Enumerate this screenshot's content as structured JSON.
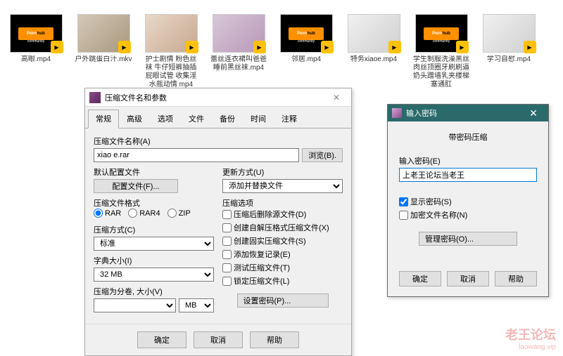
{
  "files": [
    {
      "name": "高眼.mp4",
      "thumb": "ph"
    },
    {
      "name": "户外跳蛋白汁.mkv",
      "thumb": "img1"
    },
    {
      "name": "护士剧情 粉色丝袜 牛仔短裤抽插 屁眼试管 收集淫水瓶动情 mp4",
      "thumb": "img2"
    },
    {
      "name": "蕾丝连衣裙叫爸爸睡前黑丝袜.mp4",
      "thumb": "img3"
    },
    {
      "name": "邻居.mp4",
      "thumb": "ph"
    },
    {
      "name": "特务xiaoe.mp4",
      "thumb": "img4"
    },
    {
      "name": "学生制服洗澡黑丝肉丝顶圈牙刷刷逼奶头蹭墙乳夹楼梯塞通肛",
      "thumb": "ph"
    },
    {
      "name": "学习自慰.mp4",
      "thumb": "img4"
    }
  ],
  "main_dialog": {
    "title": "压缩文件名和参数",
    "tabs": [
      "常规",
      "高级",
      "选项",
      "文件",
      "备份",
      "时间",
      "注释"
    ],
    "archive_name_label": "压缩文件名称(A)",
    "archive_name": "xiao e.rar",
    "browse": "浏览(B).",
    "profile_label": "默认配置文件",
    "profile_btn": "配置文件(F)...",
    "update_label": "更新方式(U)",
    "update_value": "添加并替换文件",
    "format_label": "压缩文件格式",
    "formats": [
      "RAR",
      "RAR4",
      "ZIP"
    ],
    "method_label": "压缩方式(C)",
    "method_value": "标准",
    "dict_label": "字典大小(I)",
    "dict_value": "32 MB",
    "split_label": "压缩为分卷, 大小(V)",
    "split_unit": "MB",
    "options_label": "压缩选项",
    "options": [
      "压缩后删除源文件(D)",
      "创建自解压格式压缩文件(X)",
      "创建固实压缩文件(S)",
      "添加恢复记录(E)",
      "测试压缩文件(T)",
      "锁定压缩文件(L)"
    ],
    "set_pwd": "设置密码(P)...",
    "ok": "确定",
    "cancel": "取消",
    "help": "帮助"
  },
  "pwd_dialog": {
    "title": "输入密码",
    "heading": "带密码压缩",
    "input_label": "输入密码(E)",
    "input_value": "上老王论坛当老王",
    "show_pwd": "显示密码(S)",
    "encrypt_names": "加密文件名称(N)",
    "manage": "管理密码(O)...",
    "ok": "确定",
    "cancel": "取消",
    "help": "帮助"
  },
  "watermark": {
    "line1": "老王论坛",
    "line2": "laowang.vip"
  }
}
